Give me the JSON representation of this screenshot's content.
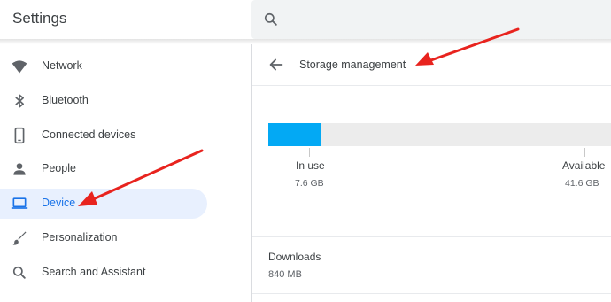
{
  "header": {
    "title": "Settings"
  },
  "search": {
    "placeholder": ""
  },
  "sidebar": {
    "items": [
      {
        "label": "Network",
        "icon": "wifi-icon"
      },
      {
        "label": "Bluetooth",
        "icon": "bluetooth-icon"
      },
      {
        "label": "Connected devices",
        "icon": "phone-icon"
      },
      {
        "label": "People",
        "icon": "person-icon"
      },
      {
        "label": "Device",
        "icon": "laptop-icon",
        "active": true
      },
      {
        "label": "Personalization",
        "icon": "brush-icon"
      },
      {
        "label": "Search and Assistant",
        "icon": "search-icon"
      }
    ]
  },
  "main": {
    "title": "Storage management",
    "storage": {
      "in_use_fraction": 0.155,
      "in_use_label": "In use",
      "in_use_value": "7.6 GB",
      "available_label": "Available",
      "available_value": "41.6 GB"
    },
    "downloads": {
      "label": "Downloads",
      "value": "840 MB"
    }
  },
  "colors": {
    "accent": "#1a73e8",
    "active_bg": "#e8f0fe",
    "storage_fill": "#03a9f4",
    "storage_track": "#ececec",
    "annotation_arrow": "#e8231e"
  }
}
